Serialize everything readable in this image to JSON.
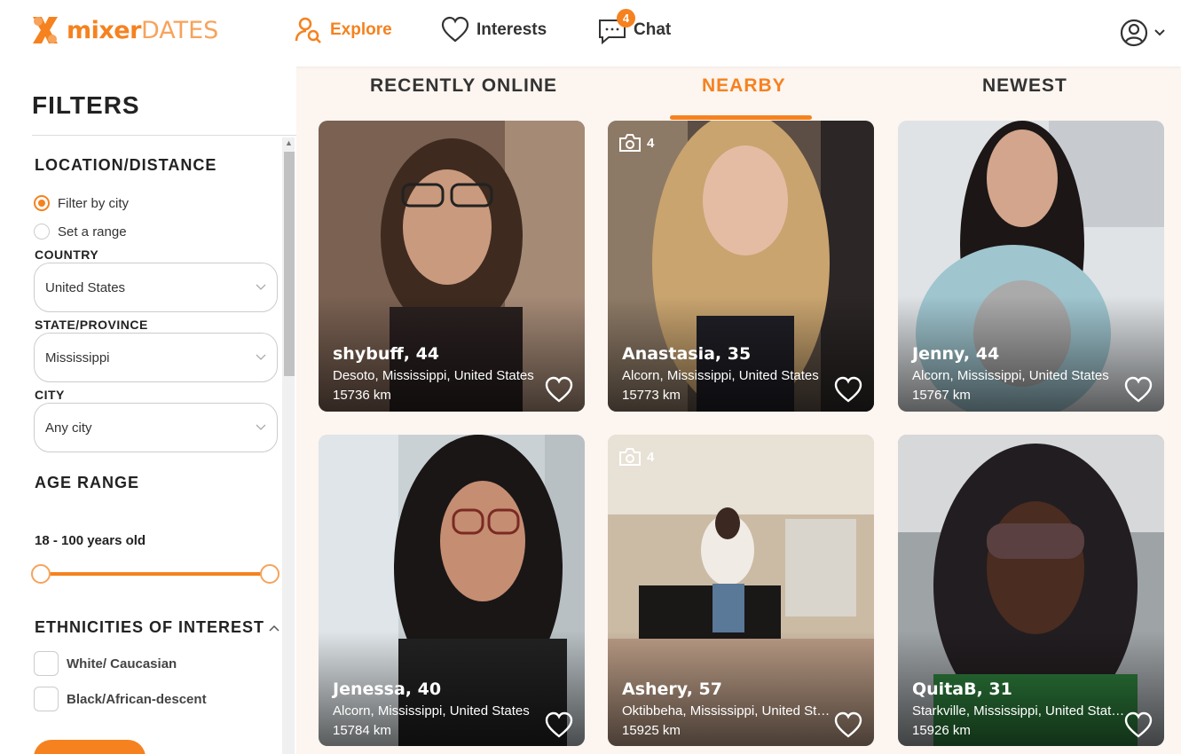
{
  "header": {
    "logo_part1": "mixer",
    "logo_part2": "DATES",
    "nav": {
      "explore": "Explore",
      "interests": "Interests",
      "chat": "Chat",
      "chat_badge": "4"
    }
  },
  "sidebar": {
    "title": "FILTERS",
    "location_title": "LOCATION/DISTANCE",
    "radio_city": "Filter by city",
    "radio_range": "Set a range",
    "selected_radio": "Filter by city",
    "country_label": "COUNTRY",
    "country_value": "United States",
    "state_label": "STATE/PROVINCE",
    "state_value": "Mississippi",
    "city_label": "CITY",
    "city_value": "Any city",
    "age_title": "AGE RANGE",
    "age_value": "18 - 100 years old",
    "age_min": 18,
    "age_max": 100,
    "eth_title": "ETHNICITIES OF INTEREST",
    "eth_options": [
      "White/ Caucasian",
      "Black/African-descent"
    ]
  },
  "tabs": {
    "recent": "RECENTLY ONLINE",
    "nearby": "NEARBY",
    "newest": "NEWEST",
    "active": "NEARBY"
  },
  "profiles": [
    {
      "name": "shybuff, 44",
      "location": "Desoto, Mississippi, United States",
      "distance": "15736 km"
    },
    {
      "name": "Anastasia, 35",
      "location": "Alcorn, Mississippi, United States",
      "distance": "15773 km",
      "photos": "4"
    },
    {
      "name": "Jenny, 44",
      "location": "Alcorn, Mississippi, United States",
      "distance": "15767 km"
    },
    {
      "name": "Jenessa, 40",
      "location": "Alcorn, Mississippi, United States",
      "distance": "15784 km"
    },
    {
      "name": "Ashery, 57",
      "location": "Oktibbeha, Mississippi, United States",
      "distance": "15925 km",
      "photos": "4"
    },
    {
      "name": "QuitaB, 31",
      "location": "Starkville, Mississippi, United States",
      "distance": "15926 km"
    }
  ],
  "colors": {
    "accent": "#f5821f",
    "background": "#fdf5f0"
  }
}
